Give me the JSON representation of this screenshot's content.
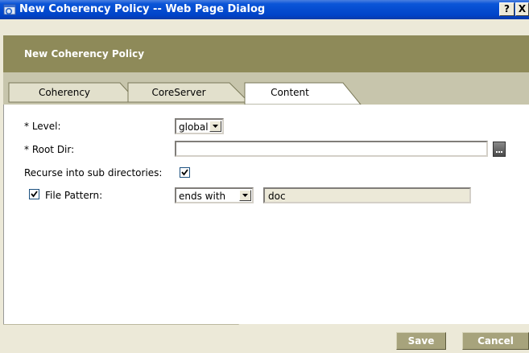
{
  "window": {
    "title": "New Coherency Policy -- Web Page Dialog",
    "help_label": "?",
    "close_label": "X"
  },
  "header": {
    "title": "New Coherency Policy"
  },
  "tabs": [
    {
      "label": "Coherency",
      "active": false
    },
    {
      "label": "CoreServer",
      "active": false
    },
    {
      "label": "Content",
      "active": true
    }
  ],
  "form": {
    "level": {
      "label": "* Level:",
      "value": "global"
    },
    "root_dir": {
      "label": "* Root Dir:",
      "value": ""
    },
    "recurse": {
      "label": "Recurse into sub directories:",
      "checked": true
    },
    "file_pattern": {
      "label": "File Pattern:",
      "checked": true,
      "match_value": "ends with",
      "pattern_value": "doc"
    }
  },
  "footer": {
    "save_label": "Save",
    "cancel_label": "Cancel"
  },
  "colors": {
    "title_bar": "#0043c8",
    "header_band": "#8e8a59",
    "tab_strip": "#c7c5ac",
    "button": "#a7a37c"
  }
}
